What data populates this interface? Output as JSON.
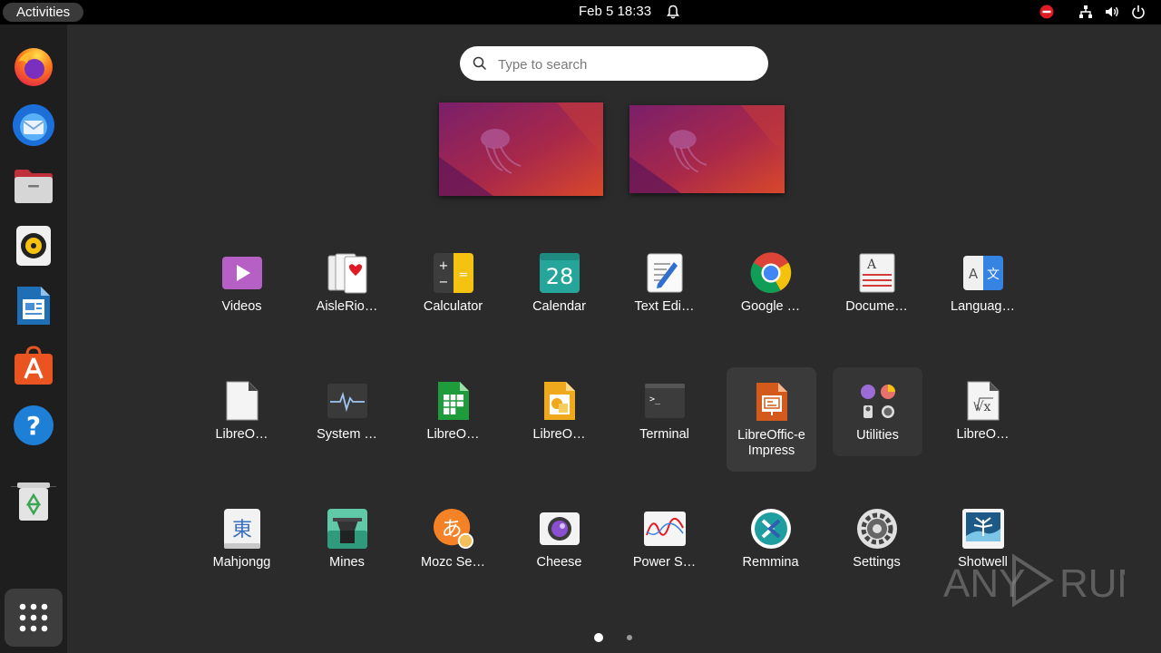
{
  "topbar": {
    "activities_label": "Activities",
    "clock": "Feb 5  18:33"
  },
  "dock": {
    "items": [
      {
        "name": "Firefox"
      },
      {
        "name": "Thunderbird"
      },
      {
        "name": "Files"
      },
      {
        "name": "Rhythmbox"
      },
      {
        "name": "LibreOffice Writer"
      },
      {
        "name": "Ubuntu Software"
      },
      {
        "name": "Help"
      },
      {
        "name": "Trash"
      }
    ]
  },
  "search": {
    "placeholder": "Type to search"
  },
  "apps": [
    {
      "label": "Videos"
    },
    {
      "label": "AisleRio…"
    },
    {
      "label": "Calculator"
    },
    {
      "label": "Calendar",
      "icon_text": "28"
    },
    {
      "label": "Text Edi…"
    },
    {
      "label": "Google …"
    },
    {
      "label": "Docume…"
    },
    {
      "label": "Languag…",
      "icon_text_a": "A",
      "icon_text_b": "文"
    },
    {
      "label": "LibreO…"
    },
    {
      "label": "System …"
    },
    {
      "label": "LibreO…"
    },
    {
      "label": "LibreO…"
    },
    {
      "label": "Terminal",
      "icon_text": ">_"
    },
    {
      "label": "LibreOffic-e Impress"
    },
    {
      "label": "Utilities"
    },
    {
      "label": "LibreO…"
    },
    {
      "label": "Mahjongg",
      "icon_text": "東"
    },
    {
      "label": "Mines"
    },
    {
      "label": "Mozc Se…",
      "icon_text": "あ"
    },
    {
      "label": "Cheese"
    },
    {
      "label": "Power S…"
    },
    {
      "label": "Remmina"
    },
    {
      "label": "Settings"
    },
    {
      "label": "Shotwell"
    }
  ],
  "pages": {
    "current": 1,
    "total": 2
  },
  "watermark": {
    "text_left": "ANY",
    "text_right": "RUN"
  },
  "colors": {
    "topbar": "#000000",
    "dock": "#1e1e1e",
    "background": "#2b2b2b",
    "power_red": "#e01b24"
  }
}
